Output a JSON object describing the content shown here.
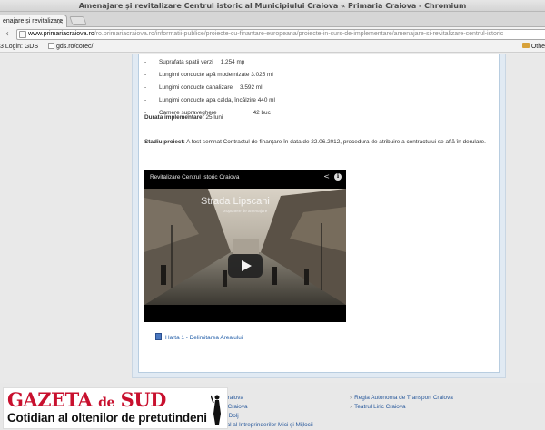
{
  "window": {
    "title": "Amenajare și revitalizare Centrul istoric al Municipiului Craiova « Primaria Craiova - Chromium"
  },
  "tab": {
    "label": "enajare și revitalizare",
    "close": "×"
  },
  "omnibox": {
    "host": "www.primariacraiova.ro",
    "path": "/ro.primariacraiova.ro/informatii-publice/proiecte-cu-finantare-europeana/proiecte-in-curs-de-implementare/amenajare-si-revitalizare-centrul-istoric"
  },
  "bookmarks": [
    {
      "label": "3 Login: GDS"
    },
    {
      "label": "gds.ro/corec/"
    }
  ],
  "bookmarks_other": "Othe",
  "content": {
    "list": [
      {
        "label": "Suprafata spatii verzi",
        "value": "1.254 mp"
      },
      {
        "label": "Lungimi conducte apă  modernizate 3.025 ml",
        "value": ""
      },
      {
        "label": "Lungimi conducte canalizare",
        "value": "3.592 ml"
      },
      {
        "label": "Lungimi conducte apa calda,  încălzire 440 ml",
        "value": ""
      },
      {
        "label": "Camere supraveghere",
        "value": "42 buc"
      }
    ],
    "durata_label": "Durata implementare:",
    "durata_value": " 25 luni",
    "stadiu_label": "Stadiu proiect:",
    "stadiu_text": " A fost semnat Contractul de finanțare în data de 22.06.2012, procedura de atribuire a contractului se află în derulare.",
    "video": {
      "title": "Revitalizare Centrul Istoric Craiova",
      "overlay_title": "Strada Lipscani",
      "overlay_sub": "propunere de amenajare"
    },
    "doc_link": "Harta 1 - Delimitarea Arealului"
  },
  "footer": {
    "links": [
      {
        "text": "tea din Craiova"
      },
      {
        "text": "ional din Craiova"
      },
      {
        "text": "ul Școlar Dolj"
      },
      {
        "text": "Regia Autonoma de Transport Craiova"
      },
      {
        "text": "Teatrul Liric Craiova"
      },
      {
        "text": "ntrul Local al Intreprinderilor Mici şi Mijlocii"
      }
    ]
  },
  "watermark": {
    "brand": "GAZETA",
    "brand_de": "de",
    "brand_end": "SUD",
    "tagline": "Cotidian al oltenilor de pretutindeni"
  },
  "colors": {
    "brand_red": "#c8102e",
    "link_blue": "#225ea8",
    "panel_border": "#b8cde0"
  }
}
